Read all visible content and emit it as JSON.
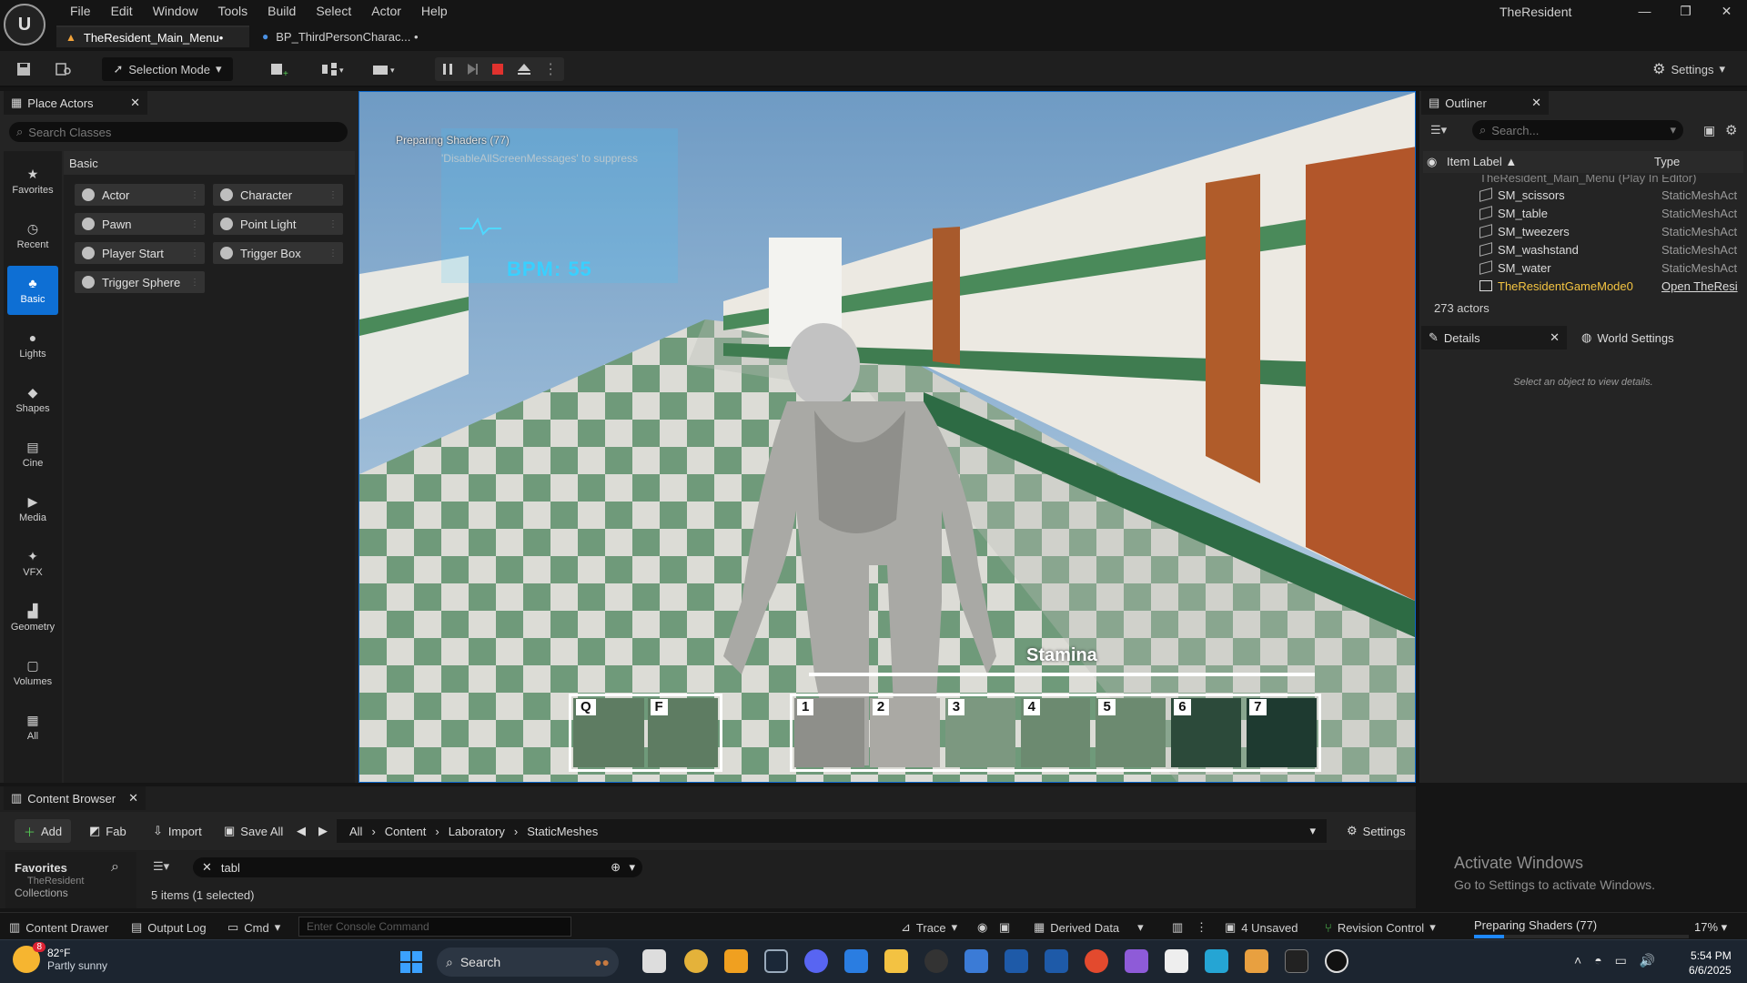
{
  "menu": {
    "items": [
      "File",
      "Edit",
      "Window",
      "Tools",
      "Build",
      "Select",
      "Actor",
      "Help"
    ]
  },
  "app_name": "TheResident",
  "window_controls": [
    "—",
    "❐",
    "✕"
  ],
  "tabs": [
    {
      "label": "TheResident_Main_Menu•"
    },
    {
      "label": "BP_ThirdPersonCharac... •"
    }
  ],
  "toolbar": {
    "selection_mode": "Selection Mode",
    "settings": "Settings"
  },
  "place_actors": {
    "title": "Place Actors",
    "search_placeholder": "Search Classes",
    "categories": [
      "Favorites",
      "Recent",
      "Basic",
      "Lights",
      "Shapes",
      "Cine",
      "Media",
      "VFX",
      "Geometry",
      "Volumes",
      "All"
    ],
    "active_category": "Basic",
    "section": "Basic",
    "items": [
      "Actor",
      "Character",
      "Pawn",
      "Point Light",
      "Player Start",
      "Trigger Box",
      "Trigger Sphere"
    ]
  },
  "viewport": {
    "preparing": "Preparing Shaders (77)",
    "suppress": "'DisableAllScreenMessages' to suppress",
    "bpm": "BPM: 55",
    "stamina": "Stamina",
    "slots_left": [
      "Q",
      "F"
    ],
    "slots_right": [
      "1",
      "2",
      "3",
      "4",
      "5",
      "6",
      "7"
    ]
  },
  "outliner": {
    "title": "Outliner",
    "search_placeholder": "Search...",
    "col_label": "Item Label ▲",
    "col_type": "Type",
    "rows": [
      {
        "label": "TheResident_Main_Menu (Play In Editor)",
        "type": ""
      },
      {
        "label": "SM_scissors",
        "type": "StaticMeshAct"
      },
      {
        "label": "SM_table",
        "type": "StaticMeshAct"
      },
      {
        "label": "SM_tweezers",
        "type": "StaticMeshAct"
      },
      {
        "label": "SM_washstand",
        "type": "StaticMeshAct"
      },
      {
        "label": "SM_water",
        "type": "StaticMeshAct"
      },
      {
        "label": "TheResidentGameMode0",
        "type": "Open TheResi"
      }
    ],
    "count": "273 actors"
  },
  "details": {
    "title": "Details",
    "world_settings": "World Settings",
    "empty_msg": "Select an object to view details."
  },
  "activate": {
    "title": "Activate Windows",
    "sub": "Go to Settings to activate Windows."
  },
  "content_browser": {
    "title": "Content Browser",
    "add": "Add",
    "fab": "Fab",
    "import": "Import",
    "save_all": "Save All",
    "path": [
      "All",
      "Content",
      "Laboratory",
      "StaticMeshes"
    ],
    "settings": "Settings",
    "favorites": "Favorites",
    "collections": "Collections",
    "project": "TheResident",
    "filter_value": "tabl",
    "items_count": "5 items (1 selected)"
  },
  "statusbar": {
    "content_drawer": "Content Drawer",
    "output_log": "Output Log",
    "cmd": "Cmd",
    "console_placeholder": "Enter Console Command",
    "trace": "Trace",
    "derived_data": "Derived Data",
    "unsaved": "4 Unsaved",
    "revision": "Revision Control",
    "preparing": "Preparing Shaders (77)",
    "progress": 0.14,
    "percent": "17%"
  },
  "taskbar": {
    "weather_badge": "8",
    "temp": "82°F",
    "weather_desc": "Partly sunny",
    "search": "Search",
    "time": "5:54 PM",
    "date": "6/6/2025"
  },
  "colors": {
    "accent": "#0e6fd4",
    "bpm": "#39d0ff",
    "slot": "#5e7c62"
  }
}
